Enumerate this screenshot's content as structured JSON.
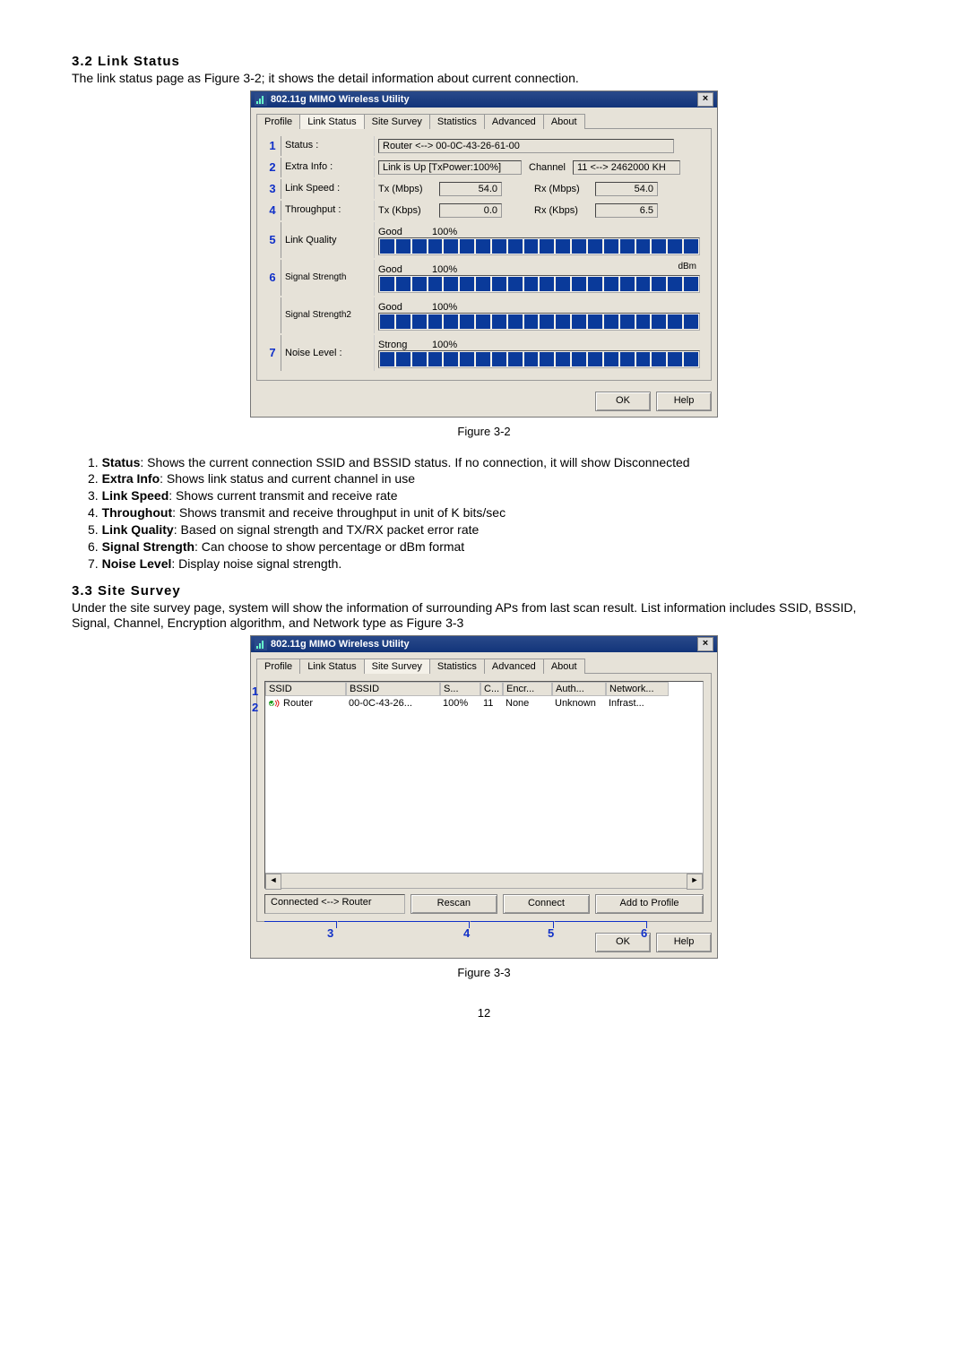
{
  "section32_heading": "3.2 Link Status",
  "section32_intro": "The link status page as Figure 3-2; it shows the detail information about current connection.",
  "fig32_caption": "Figure 3-2",
  "numlist32": [
    {
      "n": "1.",
      "b": "Status",
      "t": ": Shows the current connection SSID and BSSID status. If no connection, it will show Disconnected"
    },
    {
      "n": "2.",
      "b": "Extra Info",
      "t": ": Shows link status and current channel in use"
    },
    {
      "n": "3.",
      "b": "Link Speed",
      "t": ": Shows current transmit and receive rate"
    },
    {
      "n": "4.",
      "b": "Throughout",
      "t": ": Shows transmit and receive throughput in unit of K bits/sec"
    },
    {
      "n": "5.",
      "b": "Link Quality",
      "t": ": Based on signal strength and TX/RX packet error rate"
    },
    {
      "n": "6.",
      "b": "Signal Strength",
      "t": ": Can choose to show percentage or dBm format"
    },
    {
      "n": "7.",
      "b": "Noise Level",
      "t": ": Display noise signal strength."
    }
  ],
  "section33_heading": "3.3 Site Survey",
  "section33_intro": "Under the site survey page, system will show the information of surrounding APs from last scan result. List information includes SSID, BSSID, Signal, Channel, Encryption algorithm, and Network type as Figure 3-3",
  "fig33_caption": "Figure 3-3",
  "pagenum": "12",
  "dlg_title": "802.11g MIMO Wireless Utility",
  "tabs": [
    "Profile",
    "Link Status",
    "Site Survey",
    "Statistics",
    "Advanced",
    "About"
  ],
  "linkstatus": {
    "status_label": "Status :",
    "status_value": "Router <--> 00-0C-43-26-61-00",
    "extra_label": "Extra Info :",
    "extra_value": "Link is Up [TxPower:100%]",
    "channel_label": "Channel",
    "channel_value": "11 <--> 2462000 KH",
    "speed_label": "Link Speed :",
    "tx_mbps_label": "Tx (Mbps)",
    "tx_mbps": "54.0",
    "rx_mbps_label": "Rx (Mbps)",
    "rx_mbps": "54.0",
    "thru_label": "Throughput :",
    "tx_kbps_label": "Tx (Kbps)",
    "tx_kbps": "0.0",
    "rx_kbps_label": "Rx (Kbps)",
    "rx_kbps": "6.5",
    "lq_label": "Link Quality",
    "lq_good": "Good",
    "lq_pct": "100%",
    "ss1_label": "Signal Strength",
    "ss_good": "Good",
    "ss_pct": "100%",
    "ss_dbm": "dBm",
    "ss2_label": "Signal Strength2",
    "nl_label": "Noise Level :",
    "nl_strong": "Strong",
    "nl_pct": "100%",
    "ok": "OK",
    "help": "Help"
  },
  "survey": {
    "head": {
      "ssid": "SSID",
      "bssid": "BSSID",
      "s": "S...",
      "c": "C...",
      "encr": "Encr...",
      "auth": "Auth...",
      "net": "Network..."
    },
    "row": {
      "ssid": "Router",
      "bssid": "00-0C-43-26...",
      "s": "100%",
      "c": "11",
      "encr": "None",
      "auth": "Unknown",
      "net": "Infrast..."
    },
    "status": "Connected <--> Router",
    "rescan": "Rescan",
    "connect": "Connect",
    "add": "Add to Profile",
    "ok": "OK",
    "help": "Help",
    "callouts": {
      "c1": "1",
      "c2": "2",
      "c3": "3",
      "c4": "4",
      "c5": "5",
      "c6": "6"
    }
  },
  "ls_callouts": {
    "c1": "1",
    "c2": "2",
    "c3": "3",
    "c4": "4",
    "c5": "5",
    "c6": "6",
    "c7": "7"
  }
}
